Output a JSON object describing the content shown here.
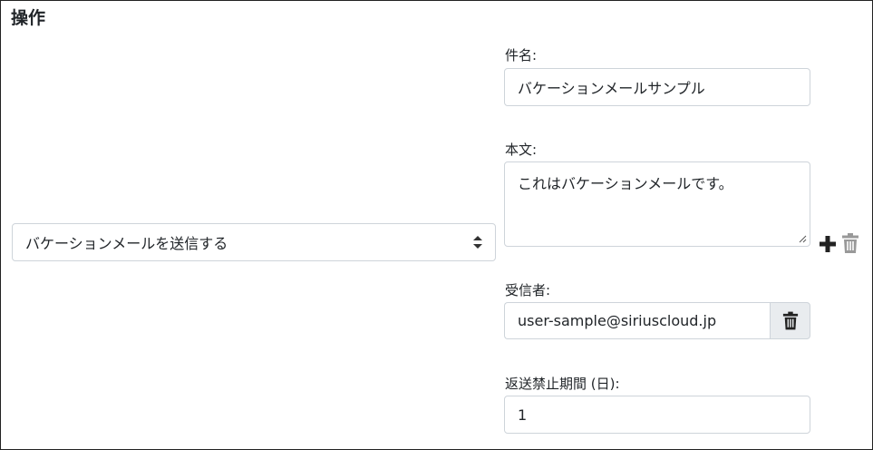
{
  "section": {
    "title": "操作"
  },
  "action": {
    "selected": "バケーションメールを送信する"
  },
  "subject": {
    "label": "件名:",
    "value": "バケーションメールサンプル"
  },
  "body": {
    "label": "本文:",
    "value": "これはバケーションメールです。"
  },
  "recipient": {
    "label": "受信者:",
    "value": "user-sample@siriuscloud.jp"
  },
  "reply_interval": {
    "label": "返送禁止期間 (日):",
    "value": "1"
  },
  "icons": {
    "select_arrows": "sort-arrows-icon",
    "recipient_delete": "trash-icon",
    "add_action": "plus-icon",
    "delete_action": "trash-icon"
  },
  "colors": {
    "border": "#ced4da",
    "text": "#212529",
    "addon_bg": "#e9ecef",
    "icon_dark": "#222222",
    "icon_muted": "#999999"
  }
}
